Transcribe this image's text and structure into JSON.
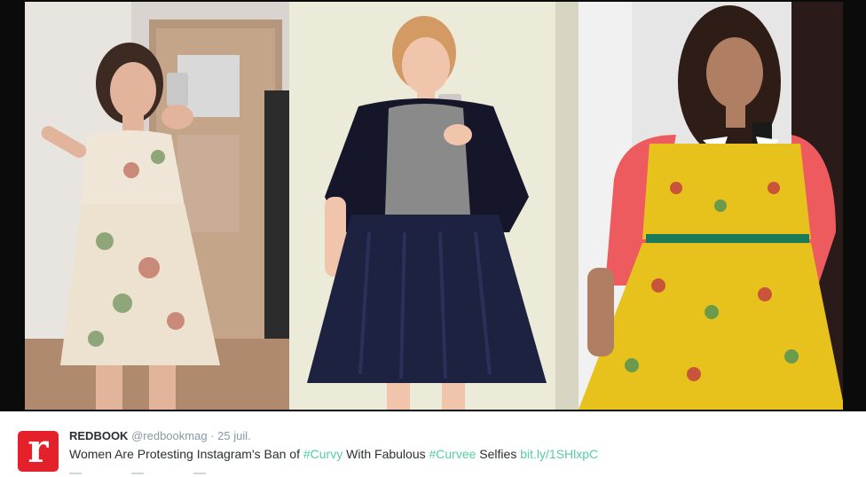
{
  "images": [
    {
      "name": "selfie-floral-dress",
      "description": "woman in floral dress"
    },
    {
      "name": "selfie-tulle-skirt",
      "description": "woman in navy tulle skirt"
    },
    {
      "name": "selfie-yellow-dress",
      "description": "woman in yellow dress"
    }
  ],
  "tweet": {
    "avatar_letter": "r",
    "display_name": "REDBOOK",
    "handle": "@redbookmag",
    "separator": "·",
    "timestamp": "25 juil.",
    "text_1": "Women Are Protesting Instagram's Ban of ",
    "hashtag_1": "#Curvy",
    "text_2": " With Fabulous ",
    "hashtag_2": "#Curvee",
    "text_3": " Selfies ",
    "link": "bit.ly/1SHlxpC"
  },
  "colors": {
    "brand": "#e4212b",
    "link": "#55ccaa",
    "text": "#292f33",
    "muted": "#8899a6"
  }
}
